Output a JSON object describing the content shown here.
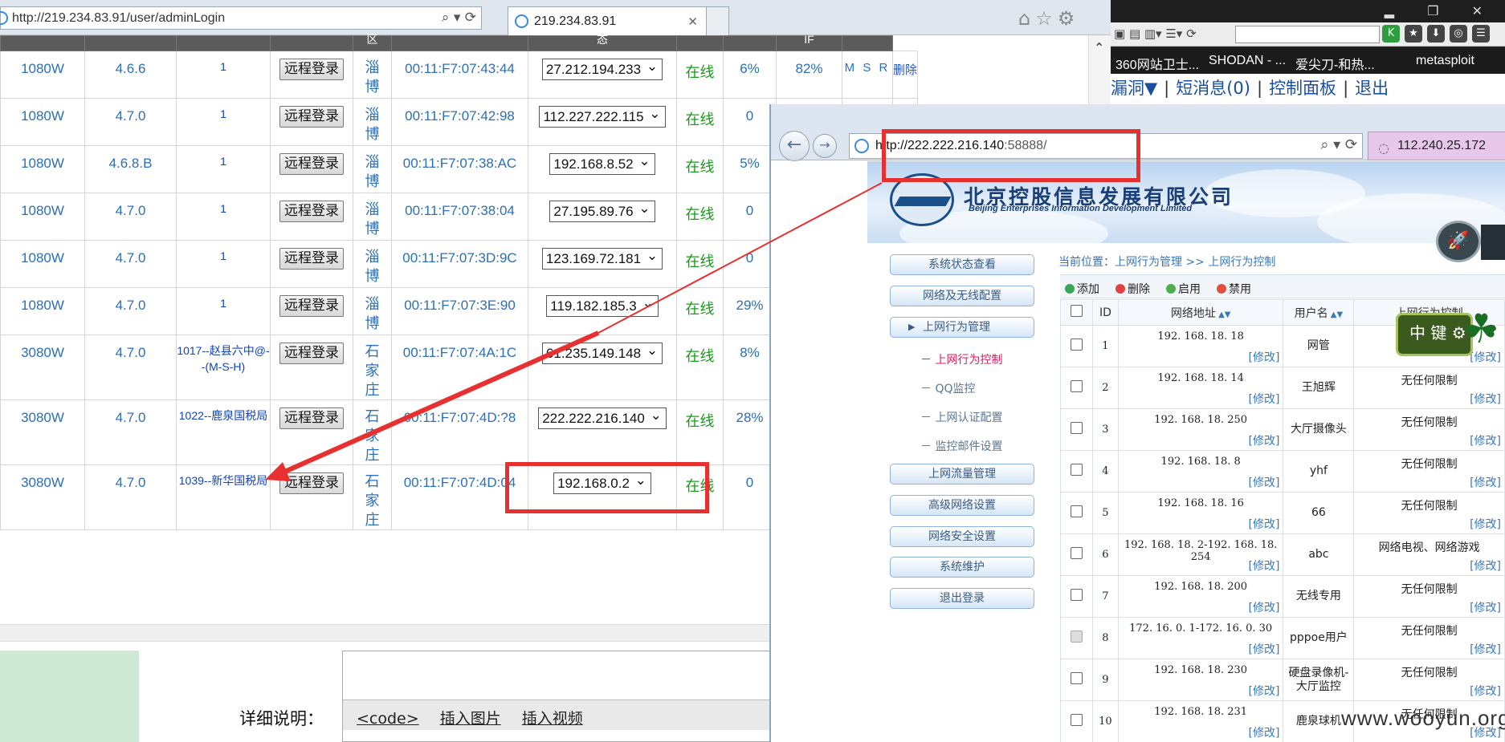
{
  "main_browser": {
    "url": "http://219.234.83.91/user/adminLogin",
    "tab_title": "219.234.83.91"
  },
  "dark_bar": {
    "bookmarks": [
      "360网站卫士...",
      "SHODAN - ...",
      "爱尖刀-和热...",
      "metasploit"
    ]
  },
  "site_nav": {
    "items": [
      "漏洞▼",
      "短消息(0)",
      "控制面板",
      "退出"
    ]
  },
  "devices": {
    "header": [
      "",
      "",
      "",
      "",
      "区",
      "",
      "态",
      "",
      "",
      "IF",
      ""
    ],
    "remote_login_label": "远程登录",
    "delete_label": "删除",
    "rows": [
      {
        "model": "1080W",
        "version": "4.6.6",
        "group": "1",
        "city": "淄博",
        "mac": "00:11:F7:07:43:44",
        "ip": "27.212.194.233",
        "status": "在线",
        "cpu": "6%",
        "mem": "82%",
        "type": "M S R",
        "op": "删除"
      },
      {
        "model": "1080W",
        "version": "4.7.0",
        "group": "1",
        "city": "淄博",
        "mac": "00:11:F7:07:42:98",
        "ip": "112.227.222.115",
        "status": "在线",
        "cpu": "0",
        "mem": "",
        "type": "",
        "op": ""
      },
      {
        "model": "1080W",
        "version": "4.6.8.B",
        "group": "1",
        "city": "淄博",
        "mac": "00:11:F7:07:38:AC",
        "ip": "192.168.8.52",
        "status": "在线",
        "cpu": "5%",
        "mem": "",
        "type": "",
        "op": ""
      },
      {
        "model": "1080W",
        "version": "4.7.0",
        "group": "1",
        "city": "淄博",
        "mac": "00:11:F7:07:38:04",
        "ip": "27.195.89.76",
        "status": "在线",
        "cpu": "0",
        "mem": "",
        "type": "",
        "op": ""
      },
      {
        "model": "1080W",
        "version": "4.7.0",
        "group": "1",
        "city": "淄博",
        "mac": "00:11:F7:07:3D:9C",
        "ip": "123.169.72.181",
        "status": "在线",
        "cpu": "0",
        "mem": "",
        "type": "",
        "op": ""
      },
      {
        "model": "1080W",
        "version": "4.7.0",
        "group": "1",
        "city": "淄博",
        "mac": "00:11:F7:07:3E:90",
        "ip": "119.182.185.3",
        "status": "在线",
        "cpu": "29%",
        "mem": "",
        "type": "",
        "op": ""
      },
      {
        "model": "3080W",
        "version": "4.7.0",
        "group": "1017--赵县六中@--(M-S-H)",
        "city": "石家庄",
        "mac": "00:11:F7:07:4A:1C",
        "ip": "61.235.149.148",
        "status": "在线",
        "cpu": "8%",
        "mem": "",
        "type": "",
        "op": ""
      },
      {
        "model": "3080W",
        "version": "4.7.0",
        "group": "1022--鹿泉国税局",
        "city": "石家庄",
        "mac": "00:11:F7:07:4D:?8",
        "ip": "222.222.216.140",
        "status": "在线",
        "cpu": "28%",
        "mem": "",
        "type": "",
        "op": ""
      },
      {
        "model": "3080W",
        "version": "4.7.0",
        "group": "1039--新华国税局",
        "city": "石家庄",
        "mac": "00:11:F7:07:4D:04",
        "ip": "192.168.0.2",
        "status": "在线",
        "cpu": "0",
        "mem": "",
        "type": "",
        "op": ""
      }
    ]
  },
  "editor": {
    "label": "详细说明：",
    "tools": [
      "<code>",
      "插入图片",
      "插入视频"
    ]
  },
  "popup": {
    "url_host": "http://222.222.216.140",
    "url_rest": ":58888/",
    "tab_title": "112.240.25.172",
    "company_cn": "北京控股信息发展有限公司",
    "company_en": "Beijing Enterprises Information Development Limited",
    "menu": [
      "系统状态查看",
      "网络及无线配置",
      "上网行为管理",
      "上网流量管理",
      "高级网络设置",
      "网络安全设置",
      "系统维护",
      "退出登录"
    ],
    "submenu": [
      "－ 上网行为控制",
      "－ QQ监控",
      "－ 上网认证配置",
      "－ 监控邮件设置"
    ],
    "breadcrumb": {
      "prefix": "当前位置：",
      "path": "上网行为管理  >>  上网行为控制"
    },
    "actions": [
      "添加",
      "删除",
      "启用",
      "禁用"
    ],
    "table": {
      "headers": [
        "",
        "ID",
        "网络地址",
        "用户名",
        "上网行为控制"
      ],
      "modify_label": "[修改]",
      "rows": [
        {
          "id": "1",
          "ip": "192. 168. 18. 18",
          "user": "网管",
          "limit": ""
        },
        {
          "id": "2",
          "ip": "192. 168. 18. 14",
          "user": "王旭辉",
          "limit": "无任何限制"
        },
        {
          "id": "3",
          "ip": "192. 168. 18. 250",
          "user": "大厅摄像头",
          "limit": "无任何限制"
        },
        {
          "id": "4",
          "ip": "192. 168. 18. 8",
          "user": "yhf",
          "limit": "无任何限制"
        },
        {
          "id": "5",
          "ip": "192. 168. 18. 16",
          "user": "66",
          "limit": "无任何限制"
        },
        {
          "id": "6",
          "ip": "192. 168. 18. 2-192. 168. 18. 254",
          "user": "abc",
          "limit": "网络电视、网络游戏"
        },
        {
          "id": "7",
          "ip": "192. 168. 18. 200",
          "user": "无线专用",
          "limit": "无任何限制"
        },
        {
          "id": "8",
          "ip": "172. 16. 0. 1-172. 16. 0. 30",
          "user": "pppoe用户",
          "limit": "无任何限制"
        },
        {
          "id": "9",
          "ip": "192. 168. 18. 230",
          "user": "硬盘录像机-大厅监控",
          "limit": "无任何限制"
        },
        {
          "id": "10",
          "ip": "192. 168. 18. 231",
          "user": "鹿泉球机",
          "limit": "无任何限制"
        }
      ]
    }
  },
  "overlays": {
    "zhongjian_label": "中",
    "zhongjian_sub": "键",
    "watermark": "www.wooyun.org"
  },
  "colors": {
    "annotation_red": "#e73030",
    "online_green": "#1a9a1a",
    "link_blue": "#2b6fb6"
  }
}
